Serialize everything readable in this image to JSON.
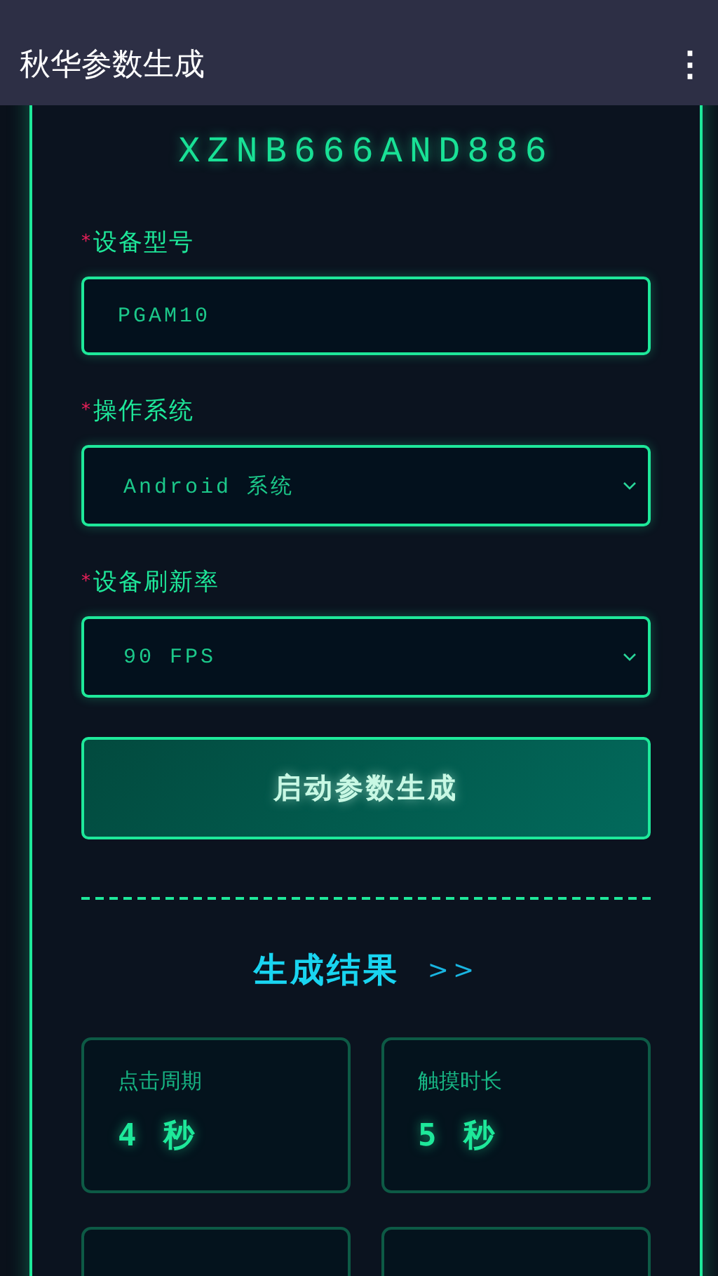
{
  "app_bar": {
    "title": "秋华参数生成",
    "menu": "⋮"
  },
  "code": "XZNB666AND886",
  "fields": [
    {
      "kind": "input",
      "required_mark": "*",
      "label": "设备型号",
      "value": "PGAM10"
    },
    {
      "kind": "select",
      "required_mark": "*",
      "label": "操作系统",
      "value": "Android 系统"
    },
    {
      "kind": "select",
      "required_mark": "*",
      "label": "设备刷新率",
      "value": "90 FPS"
    }
  ],
  "generate_button": "启动参数生成",
  "results_heading": {
    "title": "生成结果",
    "arrow": ">>"
  },
  "results": [
    {
      "label": "点击周期",
      "value": "4 秒"
    },
    {
      "label": "触摸时长",
      "value": "5 秒"
    }
  ]
}
